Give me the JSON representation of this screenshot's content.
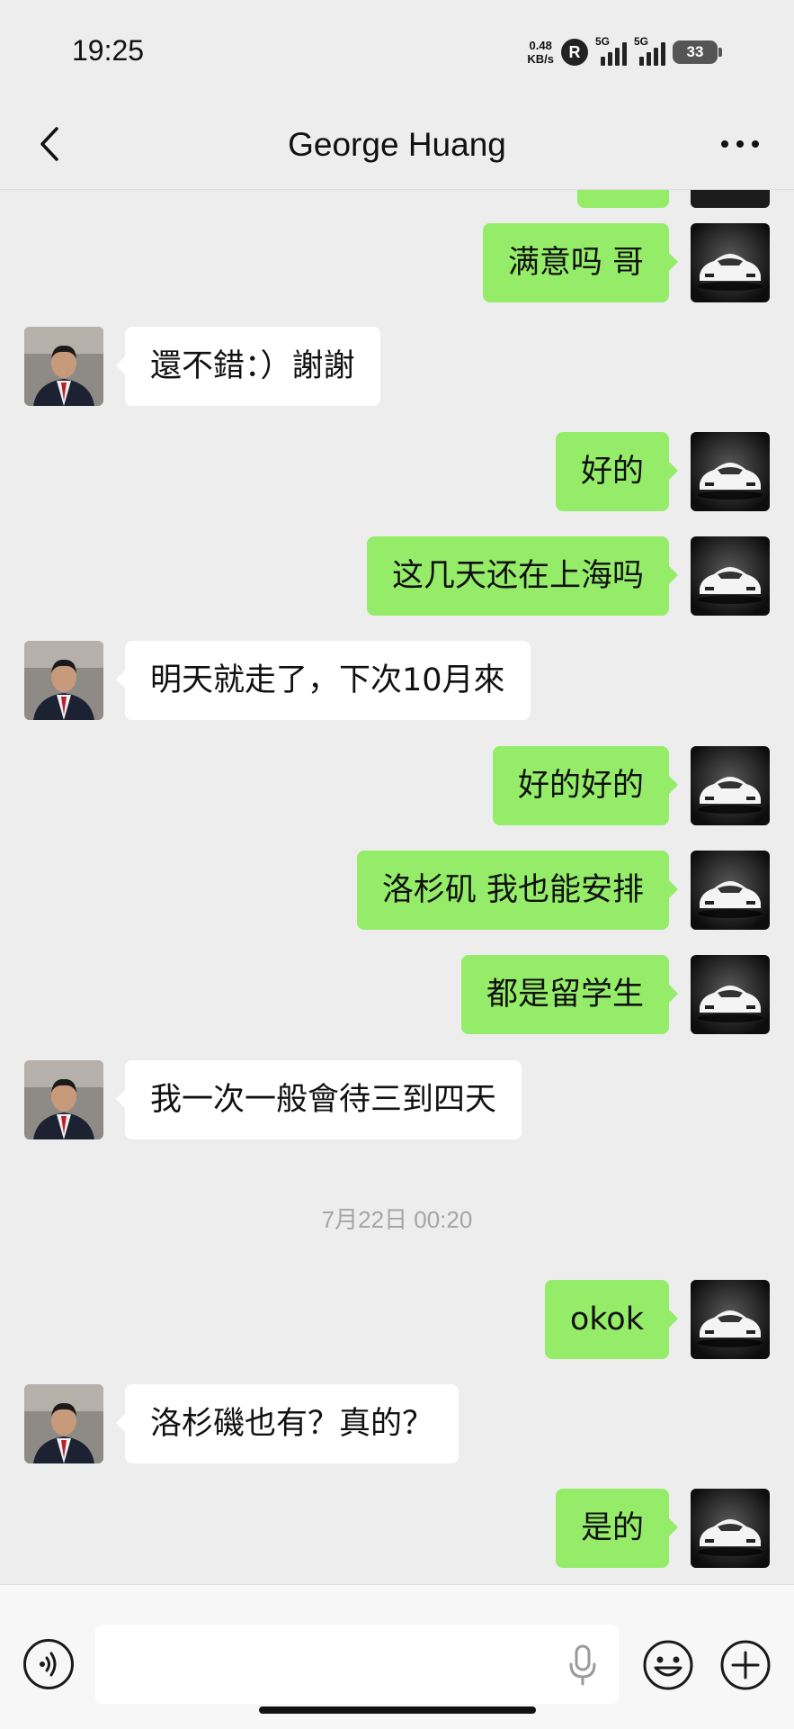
{
  "status": {
    "time": "19:25",
    "net_speed_value": "0.48",
    "net_speed_unit": "KB/s",
    "r_badge": "R",
    "sim1_label": "5G",
    "sim2_label": "5G",
    "battery": "33"
  },
  "nav": {
    "title": "George Huang"
  },
  "messages": [
    {
      "from": "me",
      "text": "满意吗 哥"
    },
    {
      "from": "them",
      "text": "還不錯：）謝謝"
    },
    {
      "from": "me",
      "text": "好的"
    },
    {
      "from": "me",
      "text": "这几天还在上海吗"
    },
    {
      "from": "them",
      "text": "明天就走了，下次10月來"
    },
    {
      "from": "me",
      "text": "好的好的"
    },
    {
      "from": "me",
      "text": "洛杉矶 我也能安排"
    },
    {
      "from": "me",
      "text": "都是留学生"
    },
    {
      "from": "them",
      "text": "我一次一般會待三到四天"
    },
    {
      "from": "timestamp",
      "text": "7月22日 00:20"
    },
    {
      "from": "me",
      "text": "okok"
    },
    {
      "from": "them",
      "text": "洛杉磯也有？真的？"
    },
    {
      "from": "me",
      "text": "是的"
    }
  ],
  "input": {
    "value": ""
  },
  "colors": {
    "background": "#ededed",
    "me_bubble": "#95ec69",
    "them_bubble": "#ffffff"
  }
}
